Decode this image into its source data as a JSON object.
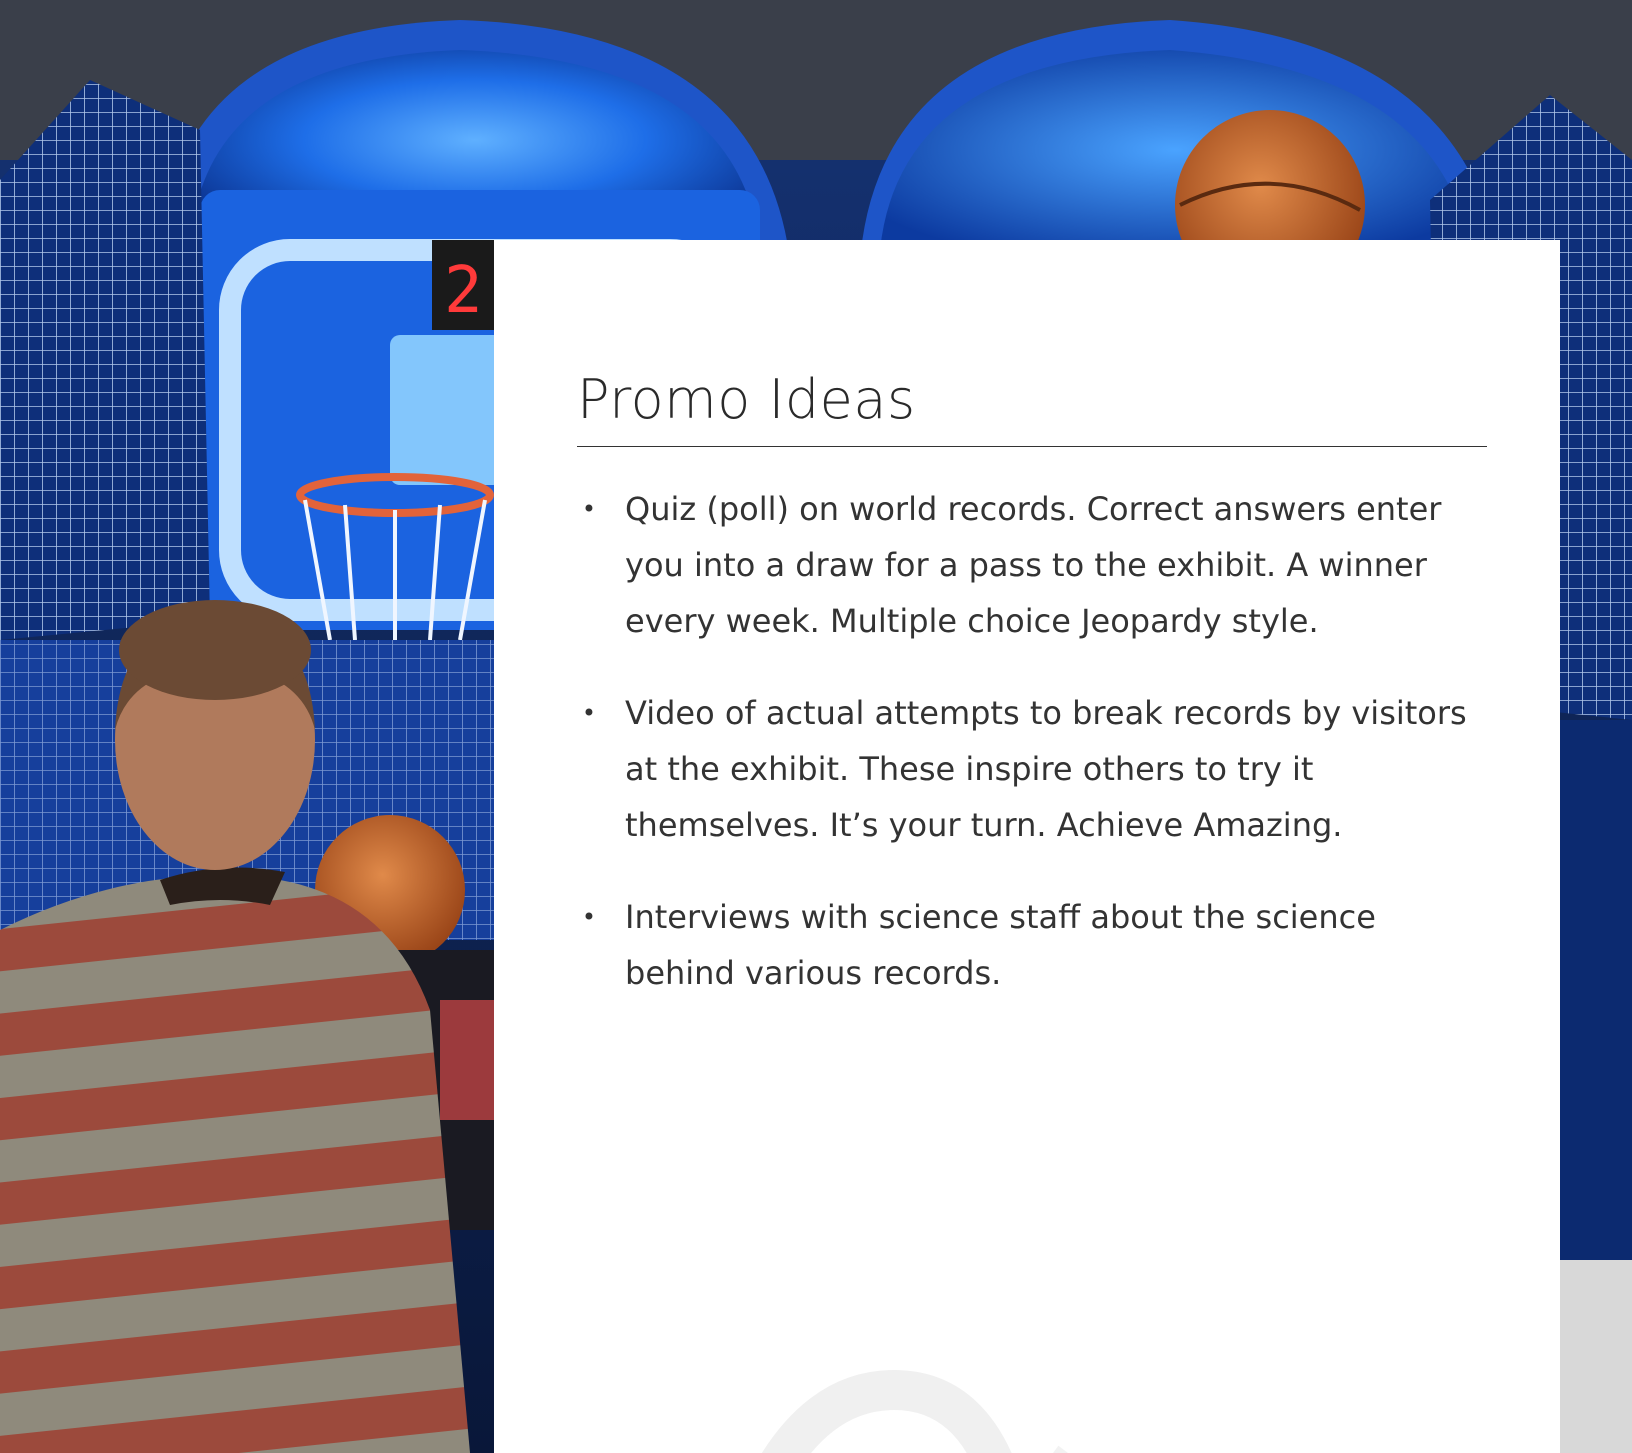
{
  "slide": {
    "title": "Promo Ideas",
    "bullets": [
      {
        "marker": "•",
        "text": "Quiz (poll) on world records. Correct answers enter you into a draw for a pass to the exhibit. A winner every week. Multiple choice Jeopardy style."
      },
      {
        "marker": "•",
        "text": "Video of actual attempts to break records by visitors at the exhibit. These inspire others to try it themselves. It’s your turn. Achieve Amazing."
      },
      {
        "marker": "•",
        "text": "Interviews with science staff about the science behind various records."
      }
    ]
  },
  "background": {
    "description_icon": "arcade-basketball-photo",
    "scoreboard_digit": "2"
  },
  "colors": {
    "panel": "#ffffff",
    "text": "#333333",
    "arcade_blue": "#1f6fe8",
    "ball_orange": "#c8682e"
  }
}
